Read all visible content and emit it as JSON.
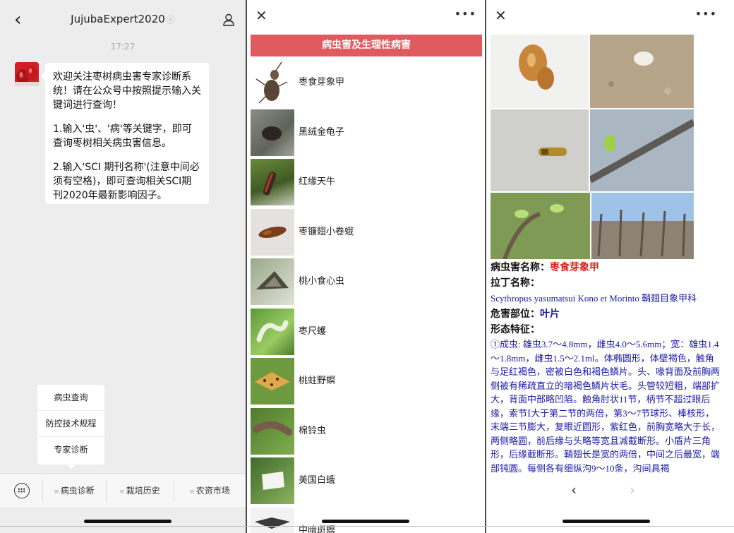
{
  "chat": {
    "title": "JujubaExpert2020",
    "time": "17:27",
    "message": {
      "para1": "欢迎关注枣树病虫害专家诊断系统！请在公众号中按照提示输入关键词进行查询！",
      "para2": "1.输入'虫'、'病'等关键字，即可查询枣树相关病虫害信息。",
      "para3": "2.输入'SCI 期刊名称'(注意中间必须有空格)，即可查询相关SCI期刊2020年最新影响因子。"
    },
    "popup_menu": [
      "病虫查询",
      "防控技术规程",
      "专家诊断"
    ],
    "menu_bar": [
      "病虫诊断",
      "栽培历史",
      "农资市场"
    ]
  },
  "list_page": {
    "header": "病虫害及生理性病害",
    "items": [
      {
        "label": "枣食芽象甲"
      },
      {
        "label": "黑绒金龟子"
      },
      {
        "label": "红缘天牛"
      },
      {
        "label": "枣镰翅小卷蛾"
      },
      {
        "label": "桃小食心虫"
      },
      {
        "label": "枣尺蠖"
      },
      {
        "label": "桃蛀野螟"
      },
      {
        "label": "棉铃虫"
      },
      {
        "label": "美国白蛾"
      },
      {
        "label": "中暗斑螟"
      }
    ]
  },
  "detail_page": {
    "name_label": "病虫害名称：",
    "name_value": "枣食芽象甲",
    "latin_label": "拉丁名称：",
    "latin_value": "Scythropus yasumatsui Kono et Morinto 鞘翅目象甲科",
    "part_label": "危害部位：",
    "part_value": "叶片",
    "morph_label": "形态特征：",
    "morph_text": "①成虫: 雄虫3.7～4.8mm，雌虫4.0～5.6mm；宽：雄虫1.4～1.8mm，雌虫1.5～2.1ml。体椭圆形，体壁褐色，触角与足红褐色，密被白色和褐色鳞片。头、喙背面及前胸两侧被有稀疏直立的暗褐色鳞片状毛。头管较短粗，端部扩大，背面中部略凹陷。触角肘状11节，柄节不超过眼后缘，索节Ⅰ大于第二节的两倍，第3～7节球形、棒核形，末端三节膨大，复眼近圆形，紫红色，前胸宽略大于长，两侧略圆，前后缘与头略等宽且减截断形。小盾片三角形，后缘截断形。鞘翅长是宽的两倍，中间之后最宽，端部钝圆。每侧各有细纵沟9～10条，沟间具褐"
  },
  "colors": {
    "header_red": "#e05b60",
    "name_red": "#e01a1a",
    "text_blue": "#1a1aa8"
  }
}
